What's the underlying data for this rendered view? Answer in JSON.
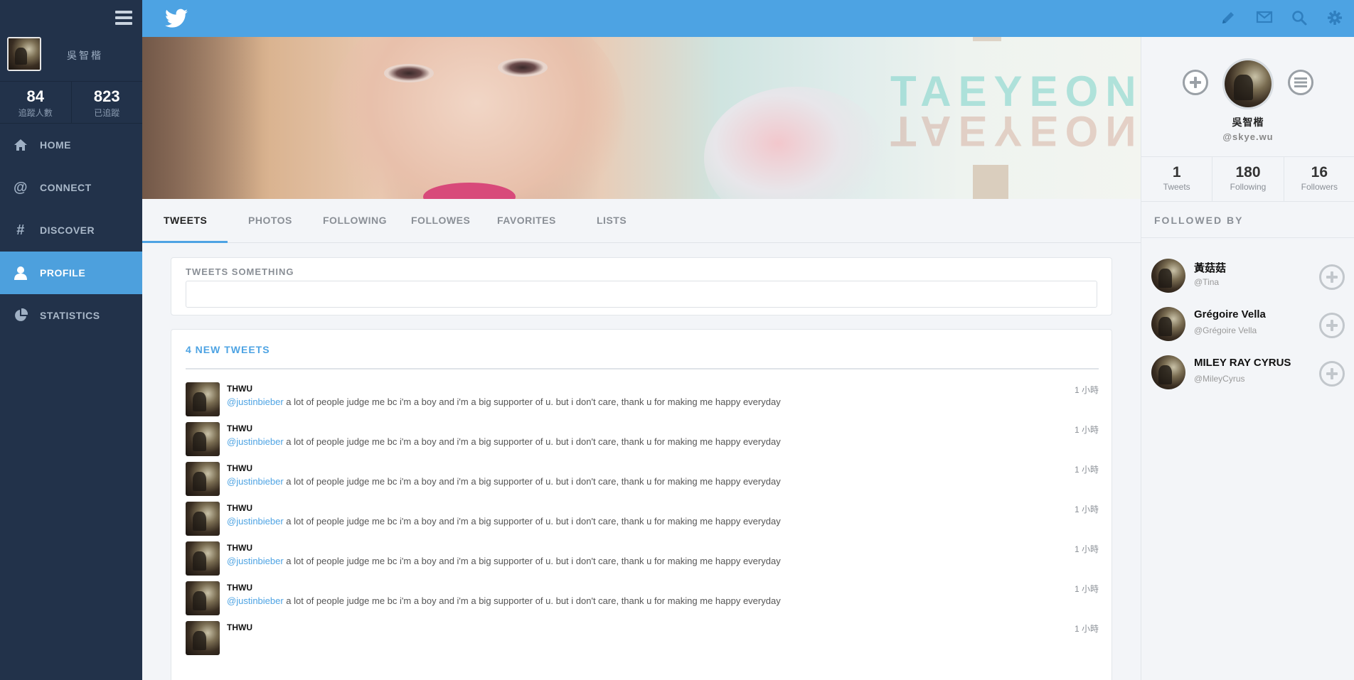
{
  "sidebar": {
    "user_name": "吳智楷",
    "stats": [
      {
        "value": "84",
        "label": "追蹤人數"
      },
      {
        "value": "823",
        "label": "已追蹤"
      }
    ],
    "nav": [
      {
        "label": "HOME",
        "icon": "home-icon"
      },
      {
        "label": "CONNECT",
        "icon": "at-icon"
      },
      {
        "label": "DISCOVER",
        "icon": "hashtag-icon"
      },
      {
        "label": "PROFILE",
        "icon": "user-icon"
      },
      {
        "label": "STATISTICS",
        "icon": "pie-chart-icon"
      }
    ]
  },
  "topbar": {
    "logo": "twitter-bird-icon",
    "icons": [
      "pencil-icon",
      "mail-icon",
      "search-icon",
      "gear-icon"
    ]
  },
  "banner": {
    "text": "TAEYEON"
  },
  "tabs": [
    "TWEETS",
    "PHOTOS",
    "FOLLOWING",
    "FOLLOWES",
    "FAVORITES",
    "LISTS"
  ],
  "compose": {
    "title": "TWEETS SOMETHING",
    "value": "",
    "placeholder": ""
  },
  "feed": {
    "new_tweets": "4 NEW TWEETS",
    "tweets": [
      {
        "user": "THWU",
        "mention": "@justinbieber",
        "text": " a lot of people judge me bc i'm a boy and i'm a big supporter of u. but i don't care, thank u for making me happy everyday",
        "time": "1 小時"
      },
      {
        "user": "THWU",
        "mention": "@justinbieber",
        "text": " a lot of people judge me bc i'm a boy and i'm a big supporter of u. but i don't care, thank u for making me happy everyday",
        "time": "1 小時"
      },
      {
        "user": "THWU",
        "mention": "@justinbieber",
        "text": " a lot of people judge me bc i'm a boy and i'm a big supporter of u. but i don't care, thank u for making me happy everyday",
        "time": "1 小時"
      },
      {
        "user": "THWU",
        "mention": "@justinbieber",
        "text": " a lot of people judge me bc i'm a boy and i'm a big supporter of u. but i don't care, thank u for making me happy everyday",
        "time": "1 小時"
      },
      {
        "user": "THWU",
        "mention": "@justinbieber",
        "text": " a lot of people judge me bc i'm a boy and i'm a big supporter of u. but i don't care, thank u for making me happy everyday",
        "time": "1 小時"
      },
      {
        "user": "THWU",
        "mention": "@justinbieber",
        "text": " a lot of people judge me bc i'm a boy and i'm a big supporter of u. but i don't care, thank u for making me happy everyday",
        "time": "1 小時"
      },
      {
        "user": "THWU",
        "mention": "",
        "text": "",
        "time": "1 小時"
      }
    ]
  },
  "profile": {
    "name": "吳智楷",
    "handle": "@skye.wu",
    "stats": [
      {
        "value": "1",
        "label": "Tweets"
      },
      {
        "value": "180",
        "label": "Following"
      },
      {
        "value": "16",
        "label": "Followers"
      }
    ],
    "followed_by_title": "FOLLOWED BY",
    "followers": [
      {
        "name": "黃菇菇",
        "handle": "@Tina"
      },
      {
        "name": "Grégoire Vella",
        "handle": "@Grégoire Vella"
      },
      {
        "name": "MILEY RAY CYRUS",
        "handle": "@MileyCyrus"
      }
    ]
  },
  "colors": {
    "accent": "#4da3e3",
    "sidebar_bg": "#22324a",
    "active_nav": "#4da0dd"
  }
}
